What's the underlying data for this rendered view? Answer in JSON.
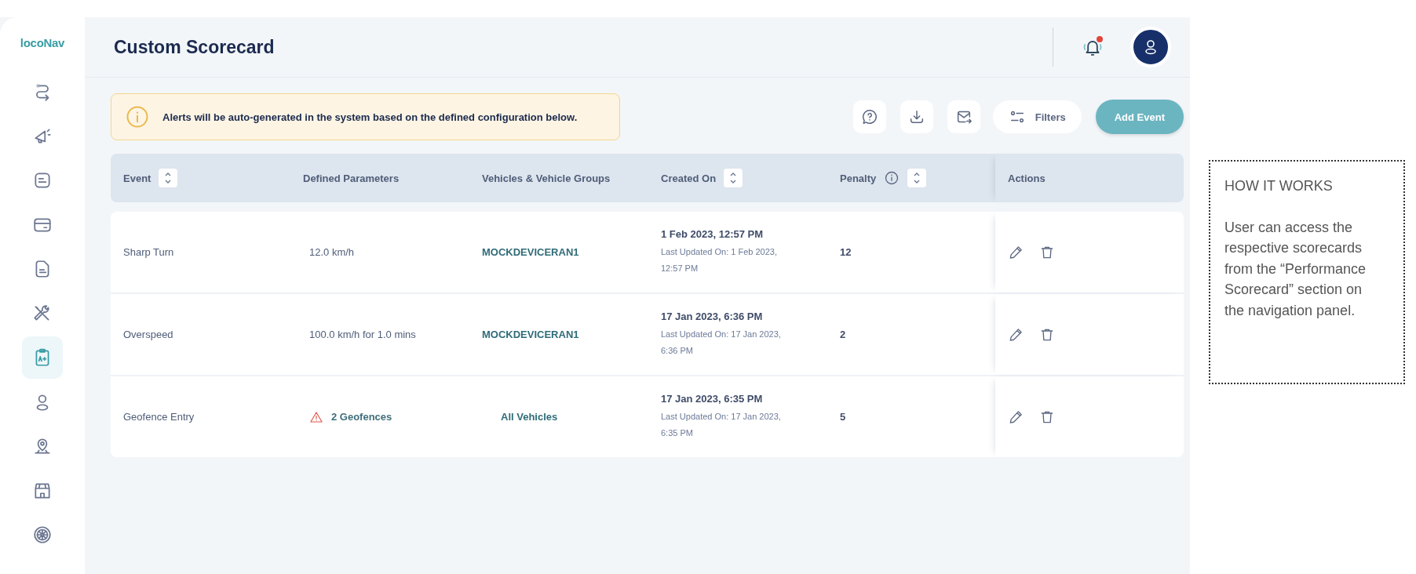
{
  "logo": "locoNav",
  "sidebar": {
    "items": [
      {
        "kind": "route",
        "selected": false
      },
      {
        "kind": "megaphone",
        "selected": false
      },
      {
        "kind": "note",
        "selected": false
      },
      {
        "kind": "card",
        "selected": false
      },
      {
        "kind": "document",
        "selected": false
      },
      {
        "kind": "tools",
        "selected": false
      },
      {
        "kind": "scorecard",
        "selected": true
      },
      {
        "kind": "person",
        "selected": false
      },
      {
        "kind": "pin",
        "selected": false
      },
      {
        "kind": "store",
        "selected": false
      },
      {
        "kind": "wheel",
        "selected": false
      }
    ]
  },
  "header": {
    "title": "Custom Scorecard",
    "notification_unread": true
  },
  "alert": {
    "text": "Alerts will be auto-generated in the system based on the defined configuration below."
  },
  "toolbar": {
    "filters": "Filters",
    "add_button": "Add Event"
  },
  "table": {
    "columns": [
      {
        "label": "Event",
        "sortable": true,
        "info": false
      },
      {
        "label": "Defined Parameters",
        "sortable": false,
        "info": false
      },
      {
        "label": "Vehicles & Vehicle Groups",
        "sortable": false,
        "info": false
      },
      {
        "label": "Created On",
        "sortable": true,
        "info": false
      },
      {
        "label": "Penalty",
        "sortable": true,
        "info": true
      },
      {
        "label": "Actions",
        "sortable": false,
        "info": false
      }
    ],
    "rows": [
      {
        "event": "Sharp Turn",
        "parameters": "12.0 km/h",
        "warning": false,
        "vehicles": "MOCKDEVICERAN1",
        "created": "1 Feb 2023, 12:57 PM",
        "updated": "Last Updated On: 1 Feb 2023, 12:57 PM",
        "penalty": "12"
      },
      {
        "event": "Overspeed",
        "parameters": "100.0 km/h for 1.0 mins",
        "warning": false,
        "vehicles": "MOCKDEVICERAN1",
        "created": "17 Jan 2023, 6:36 PM",
        "updated": "Last Updated On: 17 Jan 2023, 6:36 PM",
        "penalty": "2"
      },
      {
        "event": "Geofence Entry",
        "parameters": "2 Geofences",
        "warning": true,
        "vehicles": "All Vehicles",
        "created": "17 Jan 2023, 6:35 PM",
        "updated": "Last Updated On: 17 Jan 2023, 6:35 PM",
        "penalty": "5"
      }
    ]
  },
  "note": {
    "title": "HOW IT WORKS",
    "body": "User can access the respective scorecards from the “Performance Scorecard” section on the navigation panel."
  }
}
